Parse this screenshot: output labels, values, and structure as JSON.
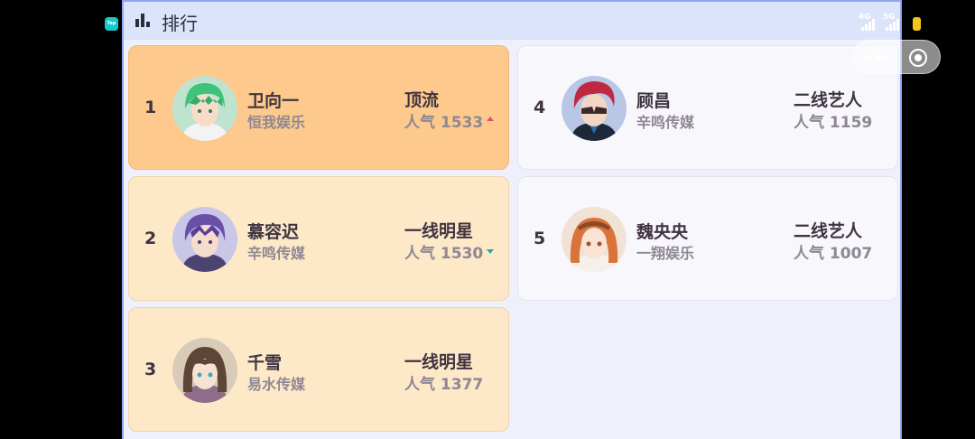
{
  "header": {
    "title": "排行"
  },
  "status_bar": {
    "net_left": "4G",
    "net_right": "5G"
  },
  "app_badge": {
    "label": "Tap"
  },
  "ranking": [
    {
      "rank": "1",
      "name": "卫向一",
      "agency": "恒我娱乐",
      "tier": "顶流",
      "popularity": "人气 1533",
      "trend": "up",
      "style": "top"
    },
    {
      "rank": "2",
      "name": "慕容迟",
      "agency": "辛鸣传媒",
      "tier": "一线明星",
      "popularity": "人气 1530",
      "trend": "down",
      "style": "star"
    },
    {
      "rank": "3",
      "name": "千雪",
      "agency": "易水传媒",
      "tier": "一线明星",
      "popularity": "人气 1377",
      "trend": "none",
      "style": "star"
    },
    {
      "rank": "4",
      "name": "顾昌",
      "agency": "辛鸣传媒",
      "tier": "二线艺人",
      "popularity": "人气 1159",
      "trend": "none",
      "style": "plain"
    },
    {
      "rank": "5",
      "name": "魏央央",
      "agency": "一翔娱乐",
      "tier": "二线艺人",
      "popularity": "人气 1007",
      "trend": "none",
      "style": "plain"
    }
  ],
  "colors": {
    "trend_up": "#e04e6e",
    "trend_down": "#28a89e",
    "top_card": "#fdc98c",
    "star_card": "#fde8c8",
    "plain_card": "#f7f7fc"
  }
}
